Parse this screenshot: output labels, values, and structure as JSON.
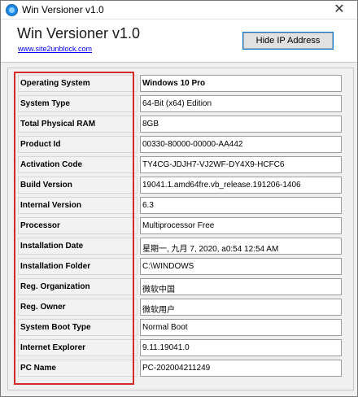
{
  "window": {
    "title": "Win Versioner v1.0",
    "close_glyph": "✕"
  },
  "header": {
    "app_title": "Win Versioner v1.0",
    "link": "www.site2unblock.com",
    "hide_ip_label": "Hide IP Address"
  },
  "icons": {
    "app": "app-icon",
    "close": "close-icon"
  },
  "colors": {
    "highlight_frame": "#d32a2a",
    "link": "#0000ee",
    "button_border": "#0078d7"
  },
  "info": [
    {
      "label": "Operating System",
      "value": "Windows 10 Pro"
    },
    {
      "label": "System Type",
      "value": "64-Bit (x64) Edition"
    },
    {
      "label": "Total Physical RAM",
      "value": "8GB"
    },
    {
      "label": "Product Id",
      "value": "00330-80000-00000-AA442"
    },
    {
      "label": "Activation Code",
      "value": "TY4CG-JDJH7-VJ2WF-DY4X9-HCFC6"
    },
    {
      "label": "Build Version",
      "value": "19041.1.amd64fre.vb_release.191206-1406"
    },
    {
      "label": "Internal Version",
      "value": "6.3"
    },
    {
      "label": "Processor",
      "value": "Multiprocessor Free"
    },
    {
      "label": "Installation Date",
      "value": "星期一, 九月 7, 2020, a0:54 12:54 AM"
    },
    {
      "label": "Installation Folder",
      "value": "C:\\WINDOWS"
    },
    {
      "label": "Reg. Organization",
      "value": "微软中国"
    },
    {
      "label": "Reg. Owner",
      "value": "微软用户"
    },
    {
      "label": "System Boot Type",
      "value": "Normal Boot"
    },
    {
      "label": "Internet Explorer",
      "value": "9.11.19041.0"
    },
    {
      "label": "PC Name",
      "value": "PC-202004211249"
    }
  ]
}
